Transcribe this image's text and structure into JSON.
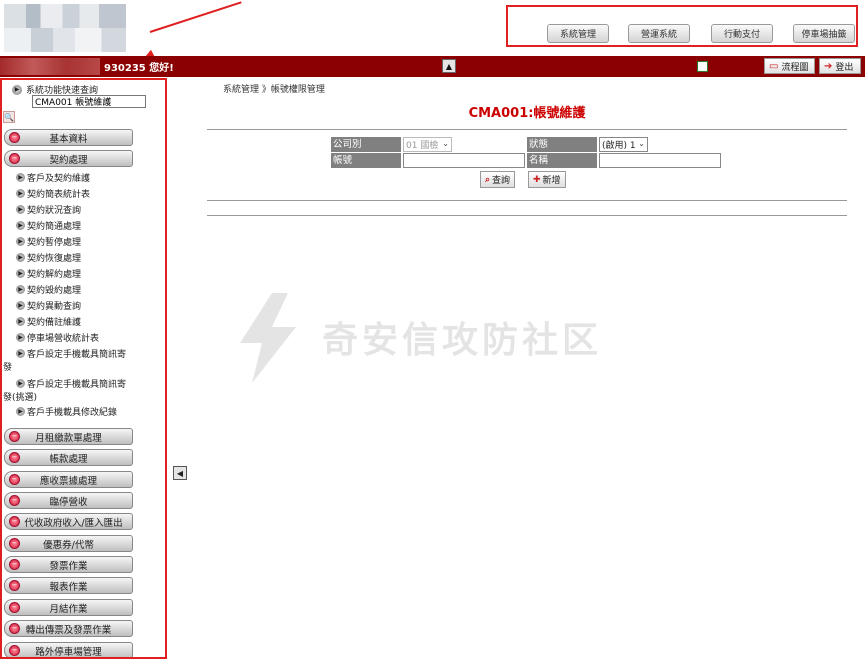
{
  "header": {
    "nav_buttons": [
      "系統管理",
      "營運系統",
      "行動支付",
      "停車場抽籤"
    ],
    "greeting": "930235 您好!",
    "flow_button": "流程圖",
    "logout_button": "登出"
  },
  "sidebar": {
    "quick_query_label": "系統功能快速查詢",
    "quick_query_value": "CMA001 帳號維護",
    "categories_top": [
      "基本資料",
      "契約處理"
    ],
    "contract_items": [
      "客戶及契約維護",
      "契約簡表統計表",
      "契約狀況查詢",
      "契約簡通處理",
      "契約暫停處理",
      "契約恢復處理",
      "契約解約處理",
      "契約毀約處理",
      "契約異動查詢",
      "契約備註維護",
      "停車場營收統計表",
      "客戶設定手機載具簡訊寄"
    ],
    "wrap_1": "發",
    "item_13": "客戶設定手機載具簡訊寄",
    "wrap_2": "發(挑選)",
    "item_14": "客戶手機載具修改紀錄",
    "categories_bottom": [
      "月租繳款單處理",
      "帳款處理",
      "應收票據處理",
      "臨停營收",
      "代收政府收入/匯入匯出",
      "優惠券/代幣",
      "發票作業",
      "報表作業",
      "月結作業",
      "轉出傳票及發票作業",
      "路外停車場管理"
    ]
  },
  "content": {
    "breadcrumb": "系統管理 》帳號權限管理",
    "title": "CMA001:帳號維護",
    "form": {
      "company_label": "公司別",
      "company_value": "01 國檢",
      "status_label": "狀態",
      "status_value": "(啟用) 1",
      "account_label": "帳號",
      "account_value": "",
      "name_label": "名稱",
      "name_value": ""
    },
    "query_button": "查詢",
    "add_button": "新增"
  },
  "watermark": "奇安信攻防社区",
  "colors": {
    "header_bar": "#8b0000",
    "title": "#cc0000",
    "annotation": "#e02020"
  }
}
